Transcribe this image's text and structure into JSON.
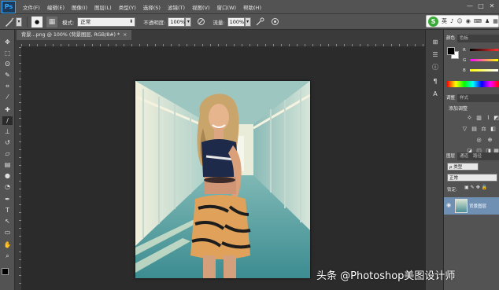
{
  "app": {
    "logo": "Ps"
  },
  "menu": [
    "文件(F)",
    "编辑(E)",
    "图像(I)",
    "图层(L)",
    "类型(Y)",
    "选择(S)",
    "滤镜(T)",
    "视图(V)",
    "窗口(W)",
    "帮助(H)"
  ],
  "window_controls": {
    "minimize": "—",
    "maximize": "□",
    "close": "✕"
  },
  "options": {
    "mode_label": "模式:",
    "mode_value": "正常",
    "opacity_label": "不透明度:",
    "opacity_value": "100%",
    "flow_label": "流量:",
    "flow_value": "100%"
  },
  "ime": {
    "logo": "S",
    "lang": "英",
    "items": [
      "♪",
      "☺",
      "◉",
      "⌨",
      "♟",
      "▦"
    ]
  },
  "document": {
    "tab_title": "背景...png @ 100% (背景图层, RGB/8#) *",
    "close": "×"
  },
  "tools": [
    {
      "name": "move-tool-icon",
      "glyph": "✥"
    },
    {
      "name": "marquee-tool-icon",
      "glyph": "⬚"
    },
    {
      "name": "lasso-tool-icon",
      "glyph": "ʘ"
    },
    {
      "name": "quick-select-tool-icon",
      "glyph": "✎"
    },
    {
      "name": "crop-tool-icon",
      "glyph": "⌗"
    },
    {
      "name": "eyedropper-tool-icon",
      "glyph": "⁄"
    },
    {
      "name": "healing-tool-icon",
      "glyph": "✚"
    },
    {
      "name": "brush-tool-icon",
      "glyph": "/"
    },
    {
      "name": "stamp-tool-icon",
      "glyph": "⊥"
    },
    {
      "name": "history-brush-tool-icon",
      "glyph": "↺"
    },
    {
      "name": "eraser-tool-icon",
      "glyph": "▱"
    },
    {
      "name": "gradient-tool-icon",
      "glyph": "▤"
    },
    {
      "name": "blur-tool-icon",
      "glyph": "●"
    },
    {
      "name": "dodge-tool-icon",
      "glyph": "◔"
    },
    {
      "name": "pen-tool-icon",
      "glyph": "✒"
    },
    {
      "name": "type-tool-icon",
      "glyph": "T"
    },
    {
      "name": "path-select-tool-icon",
      "glyph": "↖"
    },
    {
      "name": "shape-tool-icon",
      "glyph": "▭"
    },
    {
      "name": "hand-tool-icon",
      "glyph": "✋"
    },
    {
      "name": "zoom-tool-icon",
      "glyph": "⌕"
    }
  ],
  "color_panel": {
    "tabs": [
      "颜色",
      "色板"
    ],
    "channels": [
      "R",
      "G",
      "B"
    ],
    "foreground": "#000000",
    "background": "#ffffff"
  },
  "adjustments_panel": {
    "tabs": [
      "调整",
      "样式"
    ],
    "title": "添加调整"
  },
  "layers_panel": {
    "tabs": [
      "图层",
      "通道",
      "路径"
    ],
    "filter_label": "ρ 类型",
    "blend_mode": "正常",
    "lock_label": "锁定:",
    "layer_name": "背景图层"
  },
  "watermark": "头条 @Photoshop美图设计师"
}
